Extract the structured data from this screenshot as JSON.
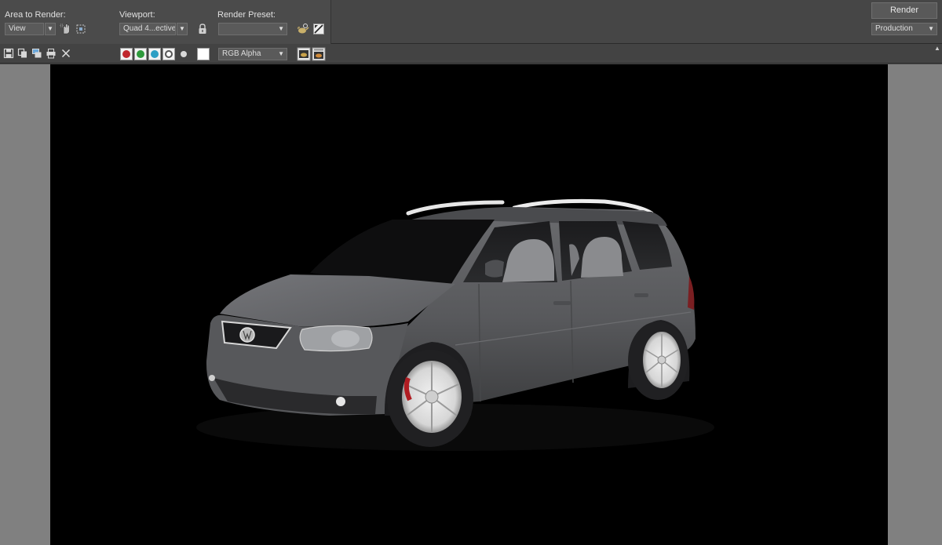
{
  "header": {
    "area_label": "Area to Render:",
    "area_value": "View",
    "viewport_label": "Viewport:",
    "viewport_value": "Quad 4...ective",
    "preset_label": "Render Preset:",
    "preset_value": "",
    "render_button": "Render",
    "production_value": "Production"
  },
  "toolbar2": {
    "channel_display": "RGB Alpha"
  },
  "colors": {
    "red_channel": "#c0262c",
    "green_channel": "#2e9a3c",
    "blue_channel": "#2c9fc4",
    "background": "#000000",
    "car_body": "#5a5b5d"
  },
  "icons": {
    "save": "save-icon",
    "copy": "copy-icon",
    "clone": "clone-window-icon",
    "print": "print-icon",
    "clear": "close-icon",
    "lock": "lock-icon",
    "region": "region-select-icon",
    "crop": "crop-icon",
    "teapot": "render-setup-icon",
    "environment": "environment-icon",
    "frame_window": "frame-window-icon",
    "render_frame": "render-frame-icon"
  }
}
